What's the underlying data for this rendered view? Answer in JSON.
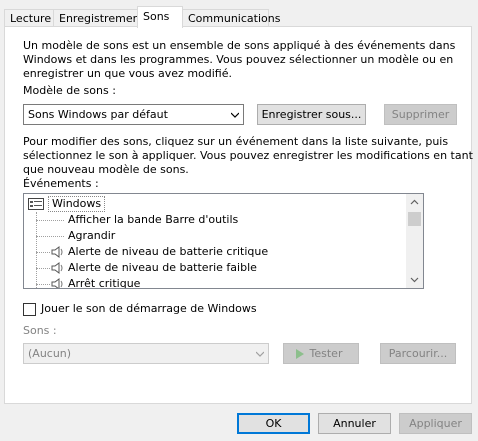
{
  "tabs": [
    {
      "label": "Lecture"
    },
    {
      "label": "Enregistrement"
    },
    {
      "label": "Sons"
    },
    {
      "label": "Communications"
    }
  ],
  "intro_line1": "Un modèle de sons est un ensemble de sons appliqué à des événements dans",
  "intro_line2": "Windows et dans les programmes. Vous pouvez sélectionner un modèle ou en",
  "intro_line3": "enregistrer un que vous avez modifié.",
  "scheme_label": "Modèle de sons :",
  "scheme_value": "Sons Windows par défaut",
  "save_as_label": "Enregistrer sous...",
  "delete_label": "Supprimer",
  "instr_line1": "Pour modifier des sons, cliquez sur un événement dans la liste suivante, puis",
  "instr_line2": "sélectionnez le son à appliquer. Vous pouvez enregistrer les modifications en tant",
  "instr_line3": "que nouveau modèle de sons.",
  "events_label": "Événements :",
  "events": [
    {
      "label": "Windows",
      "icon": "windows-folder-icon",
      "level": 0
    },
    {
      "label": "Afficher la bande Barre d'outils",
      "icon": "",
      "level": 1
    },
    {
      "label": "Agrandir",
      "icon": "",
      "level": 1
    },
    {
      "label": "Alerte de niveau de batterie critique",
      "icon": "speaker-icon",
      "level": 1
    },
    {
      "label": "Alerte de niveau de batterie faible",
      "icon": "speaker-icon",
      "level": 1
    },
    {
      "label": "Arrêt critique",
      "icon": "speaker-icon",
      "level": 1
    }
  ],
  "startup_checkbox_label": "Jouer le son de démarrage de Windows",
  "startup_checked": false,
  "sounds_label": "Sons :",
  "sounds_value": "(Aucun)",
  "test_label": "Tester",
  "browse_label": "Parcourir...",
  "ok_label": "OK",
  "cancel_label": "Annuler",
  "apply_label": "Appliquer"
}
